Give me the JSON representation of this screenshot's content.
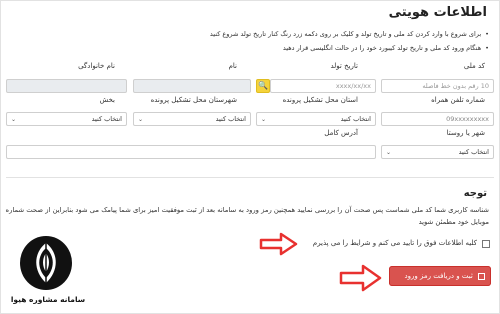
{
  "header": {
    "title": "اطلاعات هویتی"
  },
  "notes": [
    "برای شروع با وارد کردن کد ملی و تاریخ تولد و کلیک بر روی دکمه زرد رنگ کنار تاریخ تولد شروع کنید",
    "هنگام ورود کد ملی و تاریخ تولد کیبورد خود را در حالت انگلیسی قرار دهید"
  ],
  "form": {
    "national_code": {
      "label": "کد ملی",
      "placeholder": "10 رقم بدون خط فاصله"
    },
    "birth_date": {
      "label": "تاریخ تولد",
      "placeholder": "xxxx/xx/xx",
      "search_icon": "search-icon"
    },
    "first_name": {
      "label": "نام",
      "value": ""
    },
    "last_name": {
      "label": "نام خانوادگی",
      "value": ""
    },
    "mobile": {
      "label": "شماره تلفن همراه",
      "placeholder": "09xxxxxxxxx"
    },
    "province": {
      "label": "استان محل تشکیل پرونده",
      "selected": "انتخاب کنید"
    },
    "county": {
      "label": "شهرستان محل تشکیل پرونده",
      "selected": "انتخاب کنید"
    },
    "district": {
      "label": "بخش",
      "selected": "انتخاب کنید"
    },
    "city_village": {
      "label": "شهر یا روستا",
      "selected": "انتخاب کنید"
    },
    "address": {
      "label": "آدرس کامل",
      "value": ""
    }
  },
  "notice": {
    "title": "توجه",
    "text": "شناسه کاربری شما کد ملی شماست پس صحت آن را بررسی نمایید همچنین رمز ورود به سامانه بعد از ثبت موفقیت امیز برای شما پیامک می شود بنابراین از صحت شماره موبایل خود مطمئن شوید"
  },
  "agreement": {
    "label": "کلیه اطلاعات فوق را تایید می کنم و شرایط را می پذیرم",
    "checked": false
  },
  "submit": {
    "label": "ثبت و دریافت رمز ورود",
    "icon": "save-icon"
  },
  "logo": {
    "text": "سامانه مشاوره هیوا"
  },
  "colors": {
    "accent": "#f5d33b",
    "submit": "#d9534f",
    "arrow": "#e8312f"
  }
}
